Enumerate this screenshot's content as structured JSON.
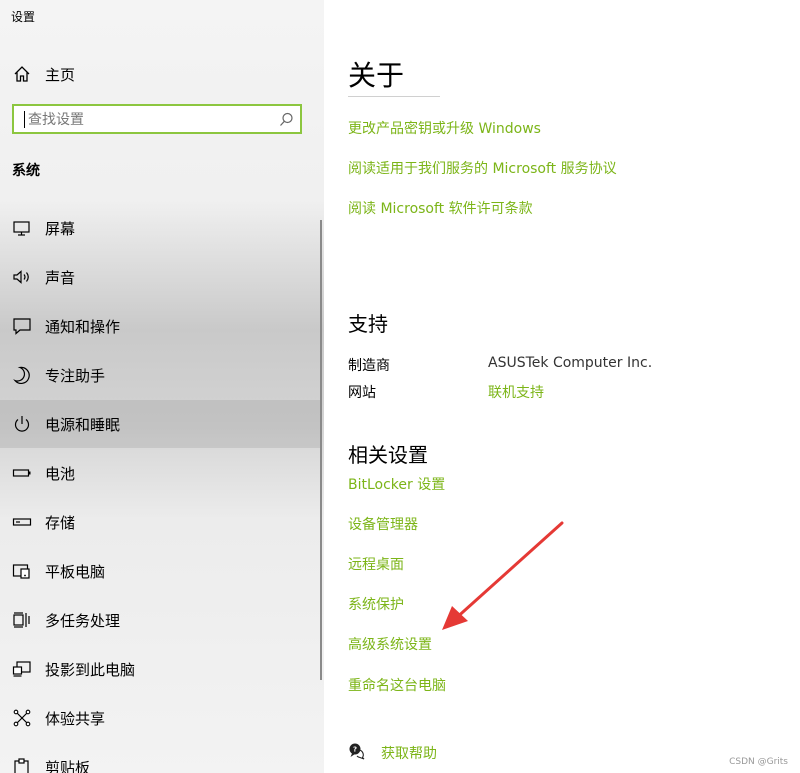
{
  "window": {
    "title": "设置"
  },
  "sidebar": {
    "home_label": "主页",
    "search_placeholder": "查找设置",
    "section_title": "系统",
    "items": [
      {
        "label": "屏幕",
        "icon": "monitor-icon"
      },
      {
        "label": "声音",
        "icon": "speaker-icon"
      },
      {
        "label": "通知和操作",
        "icon": "notification-icon"
      },
      {
        "label": "专注助手",
        "icon": "moon-icon"
      },
      {
        "label": "电源和睡眠",
        "icon": "power-icon",
        "active": true
      },
      {
        "label": "电池",
        "icon": "battery-icon"
      },
      {
        "label": "存储",
        "icon": "storage-icon"
      },
      {
        "label": "平板电脑",
        "icon": "tablet-icon"
      },
      {
        "label": "多任务处理",
        "icon": "multitask-icon"
      },
      {
        "label": "投影到此电脑",
        "icon": "project-icon"
      },
      {
        "label": "体验共享",
        "icon": "share-icon"
      },
      {
        "label": "剪贴板",
        "icon": "clipboard-icon"
      }
    ]
  },
  "main": {
    "title": "关于",
    "links": [
      "更改产品密钥或升级 Windows",
      "阅读适用于我们服务的 Microsoft 服务协议",
      "阅读 Microsoft 软件许可条款"
    ],
    "support": {
      "heading": "支持",
      "manufacturer_label": "制造商",
      "manufacturer_value": "ASUSTek Computer Inc.",
      "website_label": "网站",
      "website_value": "联机支持"
    },
    "related": {
      "heading": "相关设置",
      "links": [
        "BitLocker 设置",
        "设备管理器",
        "远程桌面",
        "系统保护",
        "高级系统设置",
        "重命名这台电脑"
      ]
    },
    "help_label": "获取帮助",
    "watermark": "CSDN @Grits"
  },
  "colors": {
    "accent": "#7cb518",
    "search_border": "#8cc63f",
    "arrow": "#e53935"
  }
}
